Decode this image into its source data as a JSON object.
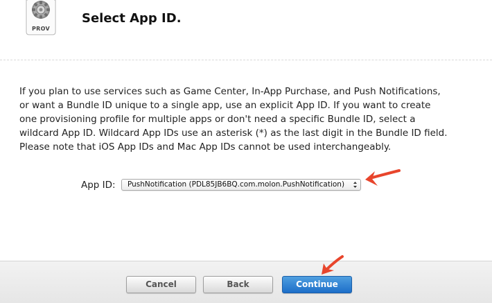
{
  "header": {
    "icon": "provisioning-profile-gear-icon",
    "icon_label": "PROV",
    "title": "Select App ID."
  },
  "description": "If you plan to use services such as Game Center, In-App Purchase, and Push Notifications, or want a Bundle ID unique to a single app, use an explicit App ID. If you want to create one provisioning profile for multiple apps or don't need a specific Bundle ID, select a wildcard App ID. Wildcard App IDs use an asterisk (*) as the last digit in the Bundle ID field. Please note that iOS App IDs and Mac App IDs cannot be used interchangeably.",
  "app_id": {
    "label": "App ID:",
    "selected_value": "PushNotification (PDL85JB6BQ.com.molon.PushNotification)"
  },
  "footer": {
    "cancel_label": "Cancel",
    "back_label": "Back",
    "continue_label": "Continue"
  },
  "colors": {
    "primary_button": "#1d6ec9",
    "annotation_arrow": "#e8452c"
  }
}
